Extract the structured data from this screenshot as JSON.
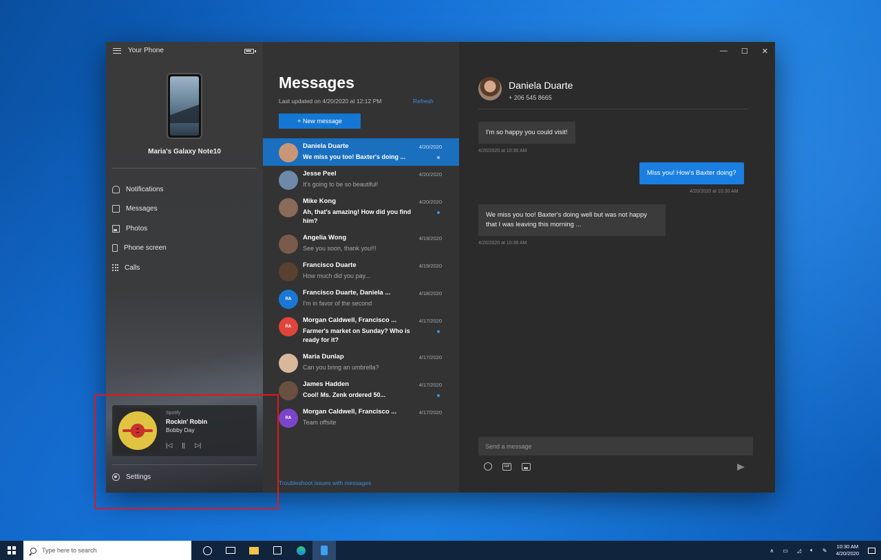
{
  "app": {
    "title": "Your Phone",
    "device_name": "Maria's Galaxy Note10"
  },
  "nav": {
    "items": [
      {
        "label": "Notifications",
        "icon": "bell-icon"
      },
      {
        "label": "Messages",
        "icon": "message-icon"
      },
      {
        "label": "Photos",
        "icon": "photo-icon"
      },
      {
        "label": "Phone screen",
        "icon": "phone-screen-icon"
      },
      {
        "label": "Calls",
        "icon": "dialpad-icon"
      }
    ],
    "settings_label": "Settings"
  },
  "media": {
    "source": "Spotify",
    "title": "Rockin' Robin",
    "artist": "Bobby Day",
    "prev": "|◁",
    "pause": "||",
    "next": "▷|"
  },
  "messages": {
    "title": "Messages",
    "last_updated": "Last updated on 4/20/2020 at 12:12 PM",
    "refresh": "Refresh",
    "new_message": "+ New message",
    "troubleshoot": "Troubleshoot issues with messages",
    "conversations": [
      {
        "name": "Daniela Duarte",
        "preview": "We miss you too! Baxter's doing ...",
        "date": "4/20/2020",
        "unread": true,
        "active": true,
        "avatar_color": "#c99778",
        "initials": ""
      },
      {
        "name": "Jesse Peel",
        "preview": "It's going to be so beautiful!",
        "date": "4/20/2020",
        "unread": false,
        "active": false,
        "avatar_color": "#6e8aa8",
        "initials": ""
      },
      {
        "name": "Mike Kong",
        "preview": "Ah, that's amazing! How did you find him?",
        "date": "4/20/2020",
        "unread": true,
        "active": false,
        "avatar_color": "#8a6a58",
        "initials": ""
      },
      {
        "name": "Angelia Wong",
        "preview": "See you soon, thank you!!!",
        "date": "4/19/2020",
        "unread": false,
        "active": false,
        "avatar_color": "#7a5a4a",
        "initials": ""
      },
      {
        "name": "Francisco Duarte",
        "preview": "How much did you pay...",
        "date": "4/19/2020",
        "unread": false,
        "active": false,
        "avatar_color": "#5a4030",
        "initials": ""
      },
      {
        "name": "Francisco Duarte, Daniela ...",
        "preview": "I'm in favor of the second",
        "date": "4/18/2020",
        "unread": false,
        "active": false,
        "avatar_color": "#1a78d4",
        "initials": "ᴿᴬ"
      },
      {
        "name": "Morgan Caldwell, Francisco ...",
        "preview": "Farmer's market on Sunday? Who is ready for it?",
        "date": "4/17/2020",
        "unread": true,
        "active": false,
        "avatar_color": "#e0443a",
        "initials": "ᴿᴬ"
      },
      {
        "name": "Maria Dunlap",
        "preview": "Can you bring an umbrella?",
        "date": "4/17/2020",
        "unread": false,
        "active": false,
        "avatar_color": "#d8b89a",
        "initials": ""
      },
      {
        "name": "James Hadden",
        "preview": "Cool! Ms. Zenk ordered 50...",
        "date": "4/17/2020",
        "unread": true,
        "active": false,
        "avatar_color": "#6a5040",
        "initials": ""
      },
      {
        "name": "Morgan Caldwell, Francisco ...",
        "preview": "Team offsite",
        "date": "4/17/2020",
        "unread": false,
        "active": false,
        "avatar_color": "#7a45c8",
        "initials": "ᴿᴬ"
      }
    ]
  },
  "chat": {
    "contact_name": "Daniela Duarte",
    "contact_phone": "+ 206 545 8665",
    "bubbles": [
      {
        "text": "I'm so happy you could visit!",
        "time": "4/20/2020 at 10:30 AM",
        "dir": "in"
      },
      {
        "text": "Miss you! How's Baxter doing?",
        "time": "4/20/2020 at 10:30 AM",
        "dir": "out"
      },
      {
        "text": "We miss you too! Baxter's doing well but was not happy that I was leaving this morning ...",
        "time": "4/20/2020 at 10:36 AM",
        "dir": "in"
      }
    ],
    "compose_placeholder": "Send a message",
    "gif_label": "GIF"
  },
  "window_controls": {
    "minimize": "—",
    "maximize": "☐",
    "close": "✕"
  },
  "taskbar": {
    "search_placeholder": "Type here to search",
    "time": "10:30 AM",
    "date": "4/20/2020"
  },
  "colors": {
    "accent": "#1477d4",
    "highlight": "#e0181e"
  }
}
